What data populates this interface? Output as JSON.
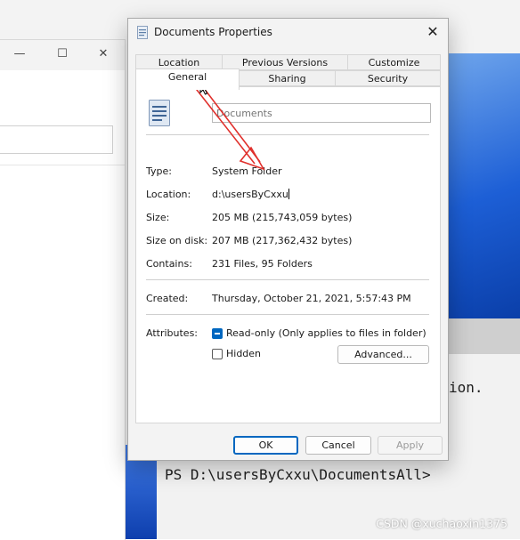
{
  "dialog": {
    "title": "Documents Properties",
    "close_glyph": "✕",
    "tabs_row1": [
      "Location",
      "Previous Versions",
      "Customize"
    ],
    "tabs_row2": [
      "General",
      "Sharing",
      "Security"
    ],
    "active_tab": "General",
    "folder_name_placeholder": "Documents",
    "rows": {
      "type_label": "Type:",
      "type_value": "System Folder",
      "location_label": "Location:",
      "location_value": "d:\\usersByCxxu",
      "size_label": "Size:",
      "size_value": "205 MB (215,743,059 bytes)",
      "size_on_disk_label": "Size on disk:",
      "size_on_disk_value": "207 MB (217,362,432 bytes)",
      "contains_label": "Contains:",
      "contains_value": "231 Files, 95 Folders",
      "created_label": "Created:",
      "created_value": "Thursday, October 21, 2021, 5:57:43 PM",
      "attributes_label": "Attributes:"
    },
    "readonly_label": "Read-only (Only applies to files in folder)",
    "readonly_checked": true,
    "hidden_label": "Hidden",
    "hidden_checked": false,
    "advanced_button": "Advanced...",
    "ok_button": "OK",
    "cancel_button": "Cancel",
    "apply_button": "Apply"
  },
  "background_window": {
    "minimize_glyph": "—",
    "maximize_glyph": "☐",
    "close_glyph": "✕"
  },
  "terminal": {
    "partial_line": "ion.",
    "prompt_line": "PS D:\\usersByCxxu\\DocumentsAll>"
  },
  "watermark": "CSDN @xuchaoxin1375",
  "colors": {
    "accent": "#0067c0",
    "arrow": "#e0302c",
    "wallpaper_blue": "#1d5fd6"
  },
  "icons": [
    "folder-doc-icon",
    "close-icon",
    "minimize-icon",
    "maximize-icon",
    "mouse-cursor-icon"
  ]
}
